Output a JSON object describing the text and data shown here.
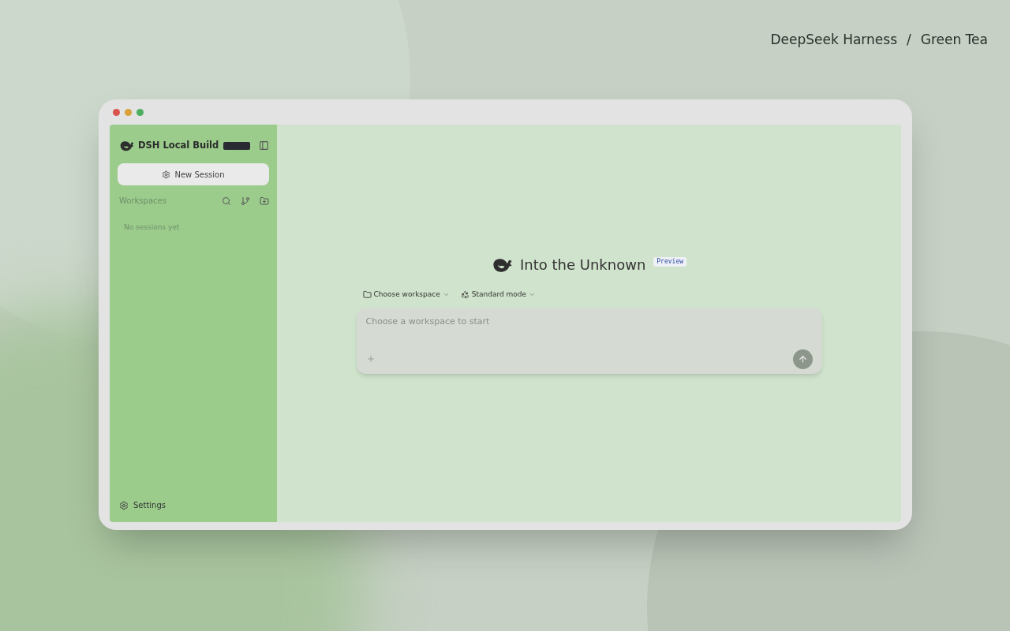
{
  "caption": {
    "product": "DeepSeek Harness",
    "separator": "/",
    "theme": "Green Tea"
  },
  "sidebar": {
    "title": "DSH Local Build",
    "new_session": "New Session",
    "section": "Workspaces",
    "empty": "No sessions yet",
    "settings": "Settings"
  },
  "main": {
    "title": "Into the Unknown",
    "badge": "Preview",
    "workspace_picker": "Choose workspace",
    "mode_picker": "Standard mode",
    "composer": {
      "placeholder": "Choose a workspace to start"
    }
  }
}
